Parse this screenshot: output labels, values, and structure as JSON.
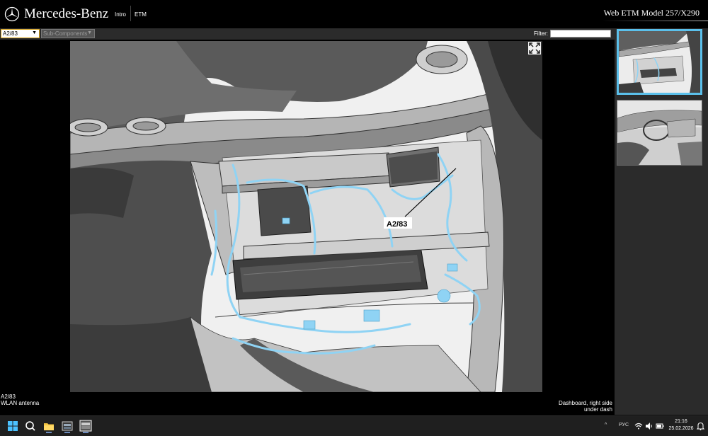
{
  "header": {
    "brand": "Mercedes-Benz",
    "nav": [
      "Intro",
      "ETM"
    ],
    "app_title": "Web ETM Model 257/X290"
  },
  "toolbar": {
    "component_select": "A2/83",
    "subcomponent_select": "Sub-Components",
    "filter_label": "Filter:",
    "filter_value": ""
  },
  "viewer": {
    "callout_label": "A2/83"
  },
  "footer": {
    "code": "A2/83",
    "name": "WLAN antenna",
    "location_line1": "Dashboard, right side",
    "location_line2": "under dash"
  },
  "taskbar": {
    "lang": "РУС",
    "time": "21:16",
    "date": "25.02.2026"
  },
  "colors": {
    "accent": "#5bc0eb",
    "wiring": "#8fd3f4",
    "select_border": "#d4a017"
  }
}
